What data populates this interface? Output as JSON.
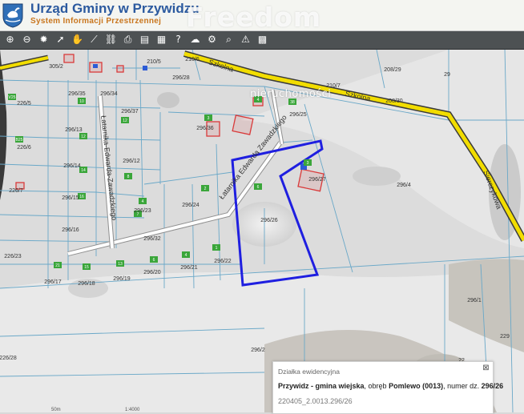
{
  "header": {
    "title": "Urząd Gminy w Przywidzu",
    "subtitle": "System Informacji Przestrzennej"
  },
  "watermark": {
    "brand": "Freedom",
    "sub": "nieruchomości"
  },
  "toolbar": {
    "tools": [
      {
        "name": "zoom-in-icon",
        "glyph": "⊕"
      },
      {
        "name": "zoom-out-icon",
        "glyph": "⊖"
      },
      {
        "name": "full-extent-icon",
        "glyph": "✹"
      },
      {
        "name": "select-arrow-icon",
        "glyph": "➚"
      },
      {
        "name": "pan-hand-icon",
        "glyph": "✋"
      },
      {
        "name": "measure-line-icon",
        "glyph": "⟋"
      },
      {
        "name": "link-icon",
        "glyph": "⛓"
      },
      {
        "name": "print-icon",
        "glyph": "⎙"
      },
      {
        "name": "save-icon",
        "glyph": "▤"
      },
      {
        "name": "layers-icon",
        "glyph": "▦"
      },
      {
        "name": "help-icon",
        "glyph": "?"
      },
      {
        "name": "upload-cloud-icon",
        "glyph": "☁"
      },
      {
        "name": "settings-icon",
        "glyph": "⚙"
      },
      {
        "name": "search-icon",
        "glyph": "⌕"
      },
      {
        "name": "warning-icon",
        "glyph": "⚠"
      },
      {
        "name": "grid-icon",
        "glyph": "▩"
      }
    ]
  },
  "colors": {
    "road": "#f2dd00",
    "parcel_line": "#6aa8c8",
    "selection": "#1f1fe0",
    "building": "#d93a3a",
    "label_bg": "#3aa63a",
    "header_title": "#2c5a9f",
    "header_subtitle": "#c9761e"
  },
  "map": {
    "road_labels": [
      "Szkolna",
      "Szkolna",
      "Łatarnika Edwarda Zawadzkiego",
      "Łatarnika-Edwarda-Zawadzkiego",
      "Sierczykowa"
    ],
    "parcels": [
      "305/2",
      "210/5",
      "210/6",
      "296/28",
      "208/29",
      "208/30",
      "29",
      "226/5",
      "296/35",
      "296/34",
      "296/37",
      "296/36",
      "296/25",
      "226/6",
      "296/13",
      "296/12",
      "210/7",
      "296/4",
      "296/27",
      "296/14",
      "226/7",
      "296/15",
      "296/24",
      "296/23",
      "296/26",
      "296/16",
      "296/32",
      "226/23",
      "296/17",
      "296/18",
      "296/19",
      "296/20",
      "296/21",
      "296/22",
      "296/1",
      "296/2",
      "226/28",
      "229",
      "22"
    ],
    "address_tags": [
      "V25",
      "B25",
      "38",
      "10",
      "12",
      "14",
      "16",
      "12",
      "8",
      "7",
      "4",
      "2",
      "6",
      "1",
      "21",
      "15",
      "13",
      "6",
      "4",
      "3",
      "4",
      "3"
    ]
  },
  "info_panel": {
    "title": "Działka ewidencyjna",
    "gmina": "Przywidz - gmina wiejska",
    "obreb_prefix": ", obręb ",
    "obreb": "Pomlewo (0013)",
    "numer_prefix": ", numer dz. ",
    "numer": "296/26",
    "id": "220405_2.0013.296/26"
  },
  "scale": {
    "left_label": "50m",
    "right_label": "1:4000"
  }
}
